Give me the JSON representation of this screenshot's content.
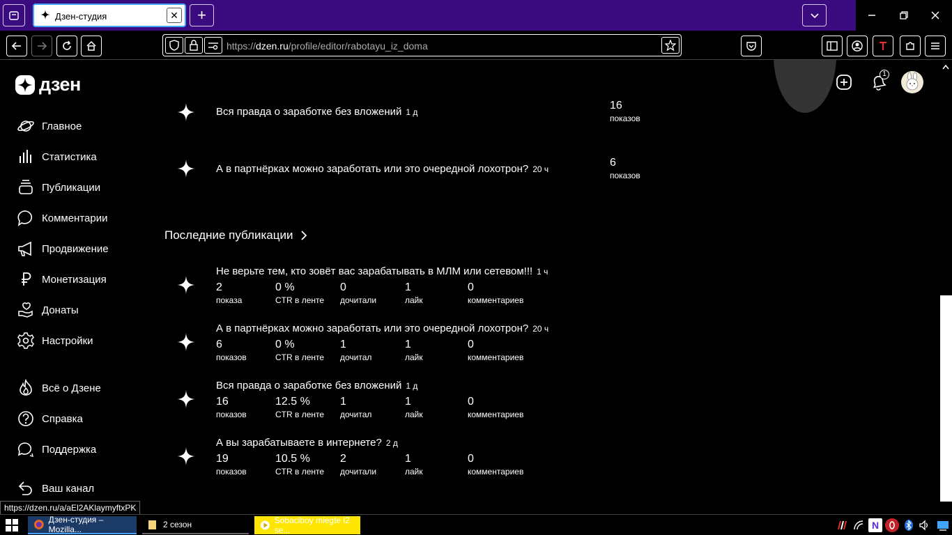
{
  "browser": {
    "tab_title": "Дзен-студия",
    "new_tab_label": "+",
    "url_host": "dzen.ru",
    "url_path": "/profile/editor/rabotayu_iz_doma",
    "url_scheme": "https://"
  },
  "brand": {
    "logo_text": "дзен",
    "accent": "#ffffff"
  },
  "sidebar": {
    "items": [
      {
        "label": "Главное",
        "icon": "planet-icon"
      },
      {
        "label": "Статистика",
        "icon": "stats-icon"
      },
      {
        "label": "Публикации",
        "icon": "stack-icon"
      },
      {
        "label": "Комментарии",
        "icon": "comment-icon"
      },
      {
        "label": "Продвижение",
        "icon": "megaphone-icon"
      },
      {
        "label": "Монетизация",
        "icon": "ruble-icon"
      },
      {
        "label": "Донаты",
        "icon": "hand-heart-icon"
      },
      {
        "label": "Настройки",
        "icon": "gear-icon"
      }
    ],
    "secondary": [
      {
        "label": "Всё о Дзене",
        "icon": "flame-icon"
      },
      {
        "label": "Справка",
        "icon": "help-icon"
      },
      {
        "label": "Поддержка",
        "icon": "chat-icon"
      },
      {
        "label": "Ваш канал",
        "icon": "back-arrow-icon"
      }
    ]
  },
  "header": {
    "notifications_count": "1"
  },
  "top_publications": [
    {
      "title": "Вся правда о заработке без вложений",
      "age": "1 д",
      "views": "16",
      "views_label": "показов"
    },
    {
      "title": "А в партнёрках можно заработать или это очередной лохотрон?",
      "age": "20 ч",
      "views": "6",
      "views_label": "показов"
    }
  ],
  "latest": {
    "section_title": "Последние публикации",
    "items": [
      {
        "title": "Не верьте тем, кто зовёт вас зарабатывать в МЛМ или сетевом!!!",
        "age": "1 ч",
        "stats": [
          {
            "v": "2",
            "l": "показа"
          },
          {
            "v": "0 %",
            "l": "CTR в ленте"
          },
          {
            "v": "0",
            "l": "дочитали"
          },
          {
            "v": "1",
            "l": "лайк"
          },
          {
            "v": "0",
            "l": "комментариев"
          }
        ]
      },
      {
        "title": "А в партнёрках можно заработать или это очередной лохотрон?",
        "age": "20 ч",
        "stats": [
          {
            "v": "6",
            "l": "показов"
          },
          {
            "v": "0 %",
            "l": "CTR в ленте"
          },
          {
            "v": "1",
            "l": "дочитал"
          },
          {
            "v": "1",
            "l": "лайк"
          },
          {
            "v": "0",
            "l": "комментариев"
          }
        ]
      },
      {
        "title": "Вся правда о заработке без вложений",
        "age": "1 д",
        "stats": [
          {
            "v": "16",
            "l": "показов"
          },
          {
            "v": "12.5 %",
            "l": "CTR в ленте"
          },
          {
            "v": "1",
            "l": "дочитал"
          },
          {
            "v": "1",
            "l": "лайк"
          },
          {
            "v": "0",
            "l": "комментариев"
          }
        ]
      },
      {
        "title": "А вы зарабатываете в интернете?",
        "age": "2 д",
        "stats": [
          {
            "v": "19",
            "l": "показов"
          },
          {
            "v": "10.5 %",
            "l": "CTR в ленте"
          },
          {
            "v": "2",
            "l": "дочитали"
          },
          {
            "v": "1",
            "l": "лайк"
          },
          {
            "v": "0",
            "l": "комментариев"
          }
        ]
      }
    ]
  },
  "status_link": "https://dzen.ru/a/aEl2AKlaymyftxPK",
  "taskbar": {
    "tasks": [
      {
        "label": "Дзен-студия – Mozilla..."
      },
      {
        "label": "2 сезон"
      },
      {
        "label": "Sobaciboy miegte l2 se..."
      }
    ]
  }
}
